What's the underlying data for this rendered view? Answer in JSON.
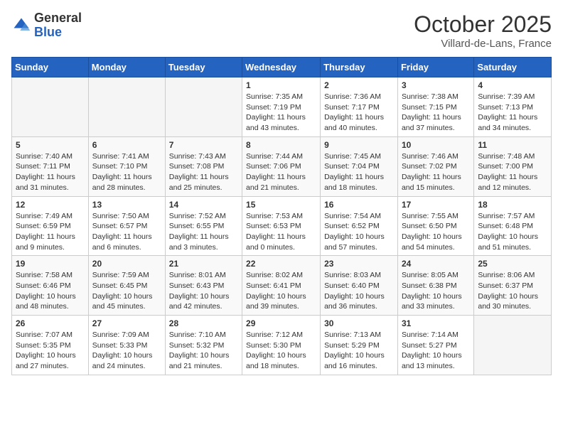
{
  "logo": {
    "general": "General",
    "blue": "Blue"
  },
  "title": "October 2025",
  "location": "Villard-de-Lans, France",
  "weekdays": [
    "Sunday",
    "Monday",
    "Tuesday",
    "Wednesday",
    "Thursday",
    "Friday",
    "Saturday"
  ],
  "weeks": [
    [
      {
        "day": "",
        "info": ""
      },
      {
        "day": "",
        "info": ""
      },
      {
        "day": "",
        "info": ""
      },
      {
        "day": "1",
        "info": "Sunrise: 7:35 AM\nSunset: 7:19 PM\nDaylight: 11 hours and 43 minutes."
      },
      {
        "day": "2",
        "info": "Sunrise: 7:36 AM\nSunset: 7:17 PM\nDaylight: 11 hours and 40 minutes."
      },
      {
        "day": "3",
        "info": "Sunrise: 7:38 AM\nSunset: 7:15 PM\nDaylight: 11 hours and 37 minutes."
      },
      {
        "day": "4",
        "info": "Sunrise: 7:39 AM\nSunset: 7:13 PM\nDaylight: 11 hours and 34 minutes."
      }
    ],
    [
      {
        "day": "5",
        "info": "Sunrise: 7:40 AM\nSunset: 7:11 PM\nDaylight: 11 hours and 31 minutes."
      },
      {
        "day": "6",
        "info": "Sunrise: 7:41 AM\nSunset: 7:10 PM\nDaylight: 11 hours and 28 minutes."
      },
      {
        "day": "7",
        "info": "Sunrise: 7:43 AM\nSunset: 7:08 PM\nDaylight: 11 hours and 25 minutes."
      },
      {
        "day": "8",
        "info": "Sunrise: 7:44 AM\nSunset: 7:06 PM\nDaylight: 11 hours and 21 minutes."
      },
      {
        "day": "9",
        "info": "Sunrise: 7:45 AM\nSunset: 7:04 PM\nDaylight: 11 hours and 18 minutes."
      },
      {
        "day": "10",
        "info": "Sunrise: 7:46 AM\nSunset: 7:02 PM\nDaylight: 11 hours and 15 minutes."
      },
      {
        "day": "11",
        "info": "Sunrise: 7:48 AM\nSunset: 7:00 PM\nDaylight: 11 hours and 12 minutes."
      }
    ],
    [
      {
        "day": "12",
        "info": "Sunrise: 7:49 AM\nSunset: 6:59 PM\nDaylight: 11 hours and 9 minutes."
      },
      {
        "day": "13",
        "info": "Sunrise: 7:50 AM\nSunset: 6:57 PM\nDaylight: 11 hours and 6 minutes."
      },
      {
        "day": "14",
        "info": "Sunrise: 7:52 AM\nSunset: 6:55 PM\nDaylight: 11 hours and 3 minutes."
      },
      {
        "day": "15",
        "info": "Sunrise: 7:53 AM\nSunset: 6:53 PM\nDaylight: 11 hours and 0 minutes."
      },
      {
        "day": "16",
        "info": "Sunrise: 7:54 AM\nSunset: 6:52 PM\nDaylight: 10 hours and 57 minutes."
      },
      {
        "day": "17",
        "info": "Sunrise: 7:55 AM\nSunset: 6:50 PM\nDaylight: 10 hours and 54 minutes."
      },
      {
        "day": "18",
        "info": "Sunrise: 7:57 AM\nSunset: 6:48 PM\nDaylight: 10 hours and 51 minutes."
      }
    ],
    [
      {
        "day": "19",
        "info": "Sunrise: 7:58 AM\nSunset: 6:46 PM\nDaylight: 10 hours and 48 minutes."
      },
      {
        "day": "20",
        "info": "Sunrise: 7:59 AM\nSunset: 6:45 PM\nDaylight: 10 hours and 45 minutes."
      },
      {
        "day": "21",
        "info": "Sunrise: 8:01 AM\nSunset: 6:43 PM\nDaylight: 10 hours and 42 minutes."
      },
      {
        "day": "22",
        "info": "Sunrise: 8:02 AM\nSunset: 6:41 PM\nDaylight: 10 hours and 39 minutes."
      },
      {
        "day": "23",
        "info": "Sunrise: 8:03 AM\nSunset: 6:40 PM\nDaylight: 10 hours and 36 minutes."
      },
      {
        "day": "24",
        "info": "Sunrise: 8:05 AM\nSunset: 6:38 PM\nDaylight: 10 hours and 33 minutes."
      },
      {
        "day": "25",
        "info": "Sunrise: 8:06 AM\nSunset: 6:37 PM\nDaylight: 10 hours and 30 minutes."
      }
    ],
    [
      {
        "day": "26",
        "info": "Sunrise: 7:07 AM\nSunset: 5:35 PM\nDaylight: 10 hours and 27 minutes."
      },
      {
        "day": "27",
        "info": "Sunrise: 7:09 AM\nSunset: 5:33 PM\nDaylight: 10 hours and 24 minutes."
      },
      {
        "day": "28",
        "info": "Sunrise: 7:10 AM\nSunset: 5:32 PM\nDaylight: 10 hours and 21 minutes."
      },
      {
        "day": "29",
        "info": "Sunrise: 7:12 AM\nSunset: 5:30 PM\nDaylight: 10 hours and 18 minutes."
      },
      {
        "day": "30",
        "info": "Sunrise: 7:13 AM\nSunset: 5:29 PM\nDaylight: 10 hours and 16 minutes."
      },
      {
        "day": "31",
        "info": "Sunrise: 7:14 AM\nSunset: 5:27 PM\nDaylight: 10 hours and 13 minutes."
      },
      {
        "day": "",
        "info": ""
      }
    ]
  ]
}
